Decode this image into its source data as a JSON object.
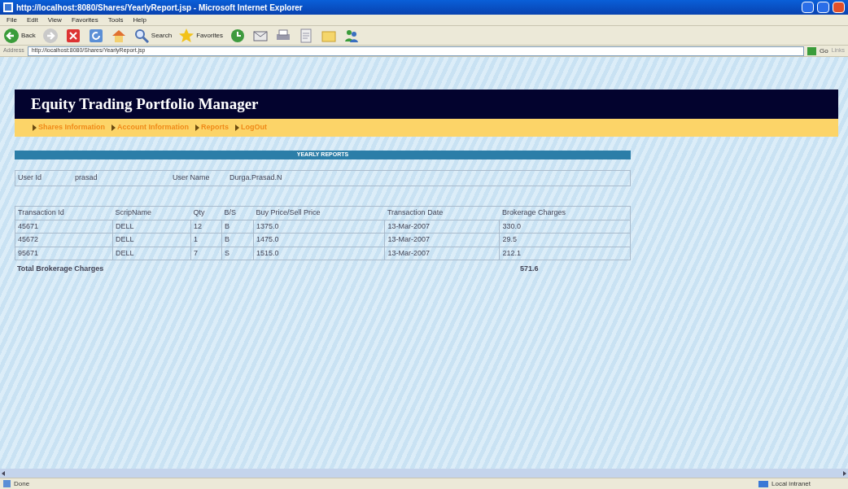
{
  "window": {
    "title": "http://localhost:8080/Shares/YearlyReport.jsp - Microsoft Internet Explorer"
  },
  "menu": [
    "File",
    "Edit",
    "View",
    "Favorites",
    "Tools",
    "Help"
  ],
  "toolbar": [
    {
      "kind": "back",
      "label": "Back"
    },
    {
      "kind": "forward"
    },
    {
      "kind": "stop"
    },
    {
      "kind": "refresh"
    },
    {
      "kind": "home"
    },
    {
      "kind": "search",
      "label": "Search"
    },
    {
      "kind": "favorites",
      "label": "Favorites"
    },
    {
      "kind": "history"
    },
    {
      "kind": "mail"
    },
    {
      "kind": "print"
    },
    {
      "kind": "edit"
    },
    {
      "kind": "folder"
    },
    {
      "kind": "messenger"
    }
  ],
  "address": {
    "label": "Address",
    "value": "http://localhost:8080/Shares/YearlyReport.jsp",
    "go": "Go",
    "links": "Links"
  },
  "page": {
    "title": "Equity Trading Portfolio Manager",
    "nav": [
      "Shares Information",
      "Account Information",
      "Reports",
      "LogOut"
    ],
    "section": "YEARLY REPORTS",
    "user": [
      {
        "label": "User Id",
        "value": "prasad"
      },
      {
        "label": "User Name",
        "value": "Durga.Prasad.N"
      }
    ],
    "table": {
      "columns": [
        "Transaction Id",
        "ScripName",
        "Qty",
        "B/S",
        "Buy Price/Sell Price",
        "Transaction Date",
        "Brokerage Charges"
      ],
      "rows": [
        [
          "45671",
          "DELL",
          "12",
          "B",
          "1375.0",
          "13-Mar-2007",
          "330.0"
        ],
        [
          "45672",
          "DELL",
          "1",
          "B",
          "1475.0",
          "13-Mar-2007",
          "29.5"
        ],
        [
          "95671",
          "DELL",
          "7",
          "S",
          "1515.0",
          "13-Mar-2007",
          "212.1"
        ]
      ]
    },
    "total": {
      "label": "Total Brokerage Charges",
      "value": "571.6"
    }
  },
  "status_bar": {
    "text": "Done",
    "zone": "Local intranet"
  }
}
